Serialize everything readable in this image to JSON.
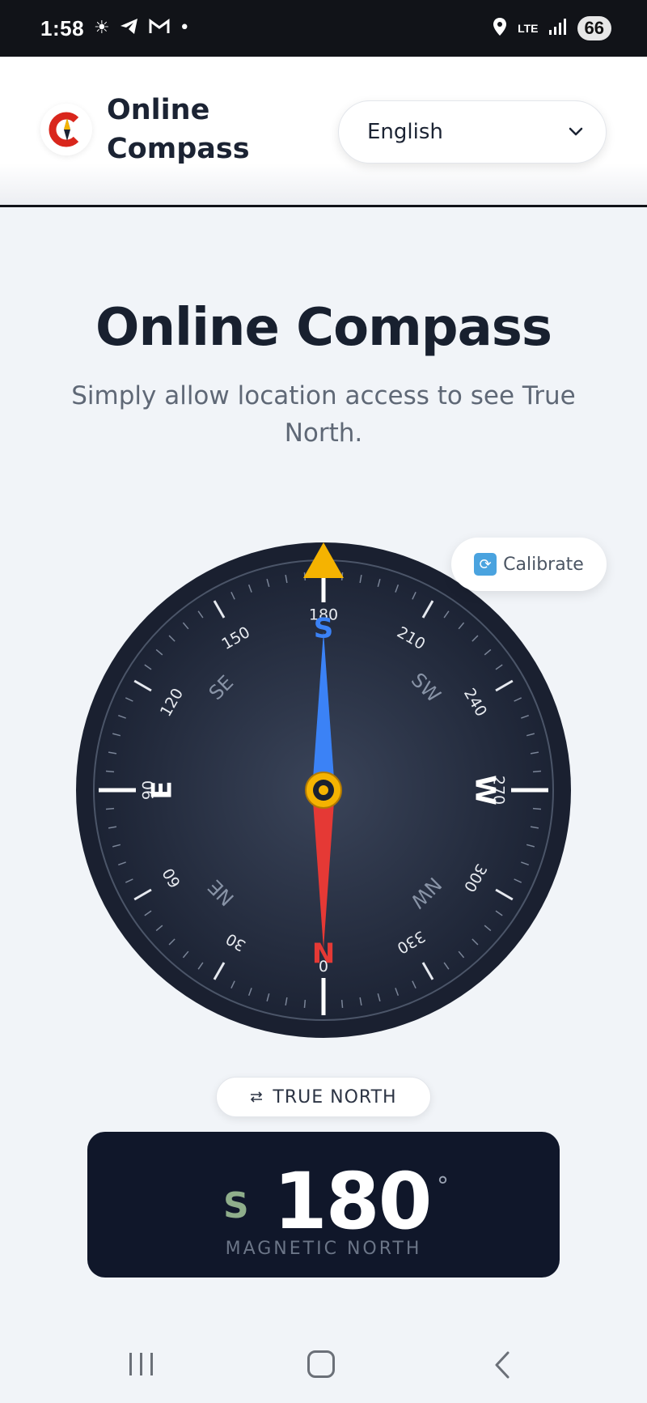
{
  "status_bar": {
    "time": "1:58",
    "network": "LTE",
    "battery": "66",
    "icons": [
      "brightness-icon",
      "telegram-icon",
      "gmail-icon",
      "dot-icon",
      "location-icon",
      "signal-icon"
    ]
  },
  "header": {
    "brand_line1": "Online",
    "brand_line2": "Compass",
    "language": {
      "selected": "English"
    }
  },
  "hero": {
    "title": "Online Compass",
    "subtitle": "Simply allow location access to see True North."
  },
  "calibrate": {
    "label": "Calibrate"
  },
  "compass": {
    "heading_degrees": 180,
    "cardinals": [
      "N",
      "E",
      "S",
      "W"
    ],
    "intercardinals": [
      "NE",
      "SE",
      "SW",
      "NW"
    ],
    "degree_labels": [
      "0",
      "30",
      "60",
      "90",
      "120",
      "150",
      "180",
      "210",
      "240",
      "270",
      "300",
      "330"
    ],
    "colors": {
      "dial": "#1e2638",
      "needle_north": "#e53935",
      "needle_south": "#3b82f6",
      "pointer": "#f5b301"
    }
  },
  "toggle": {
    "label": "TRUE NORTH",
    "icon": "swap-icon"
  },
  "heading": {
    "direction": "S",
    "value": "180",
    "unit": "°",
    "reference": "MAGNETIC NORTH"
  },
  "nav": {
    "icons": [
      "recent-apps-icon",
      "home-icon",
      "back-icon"
    ]
  }
}
